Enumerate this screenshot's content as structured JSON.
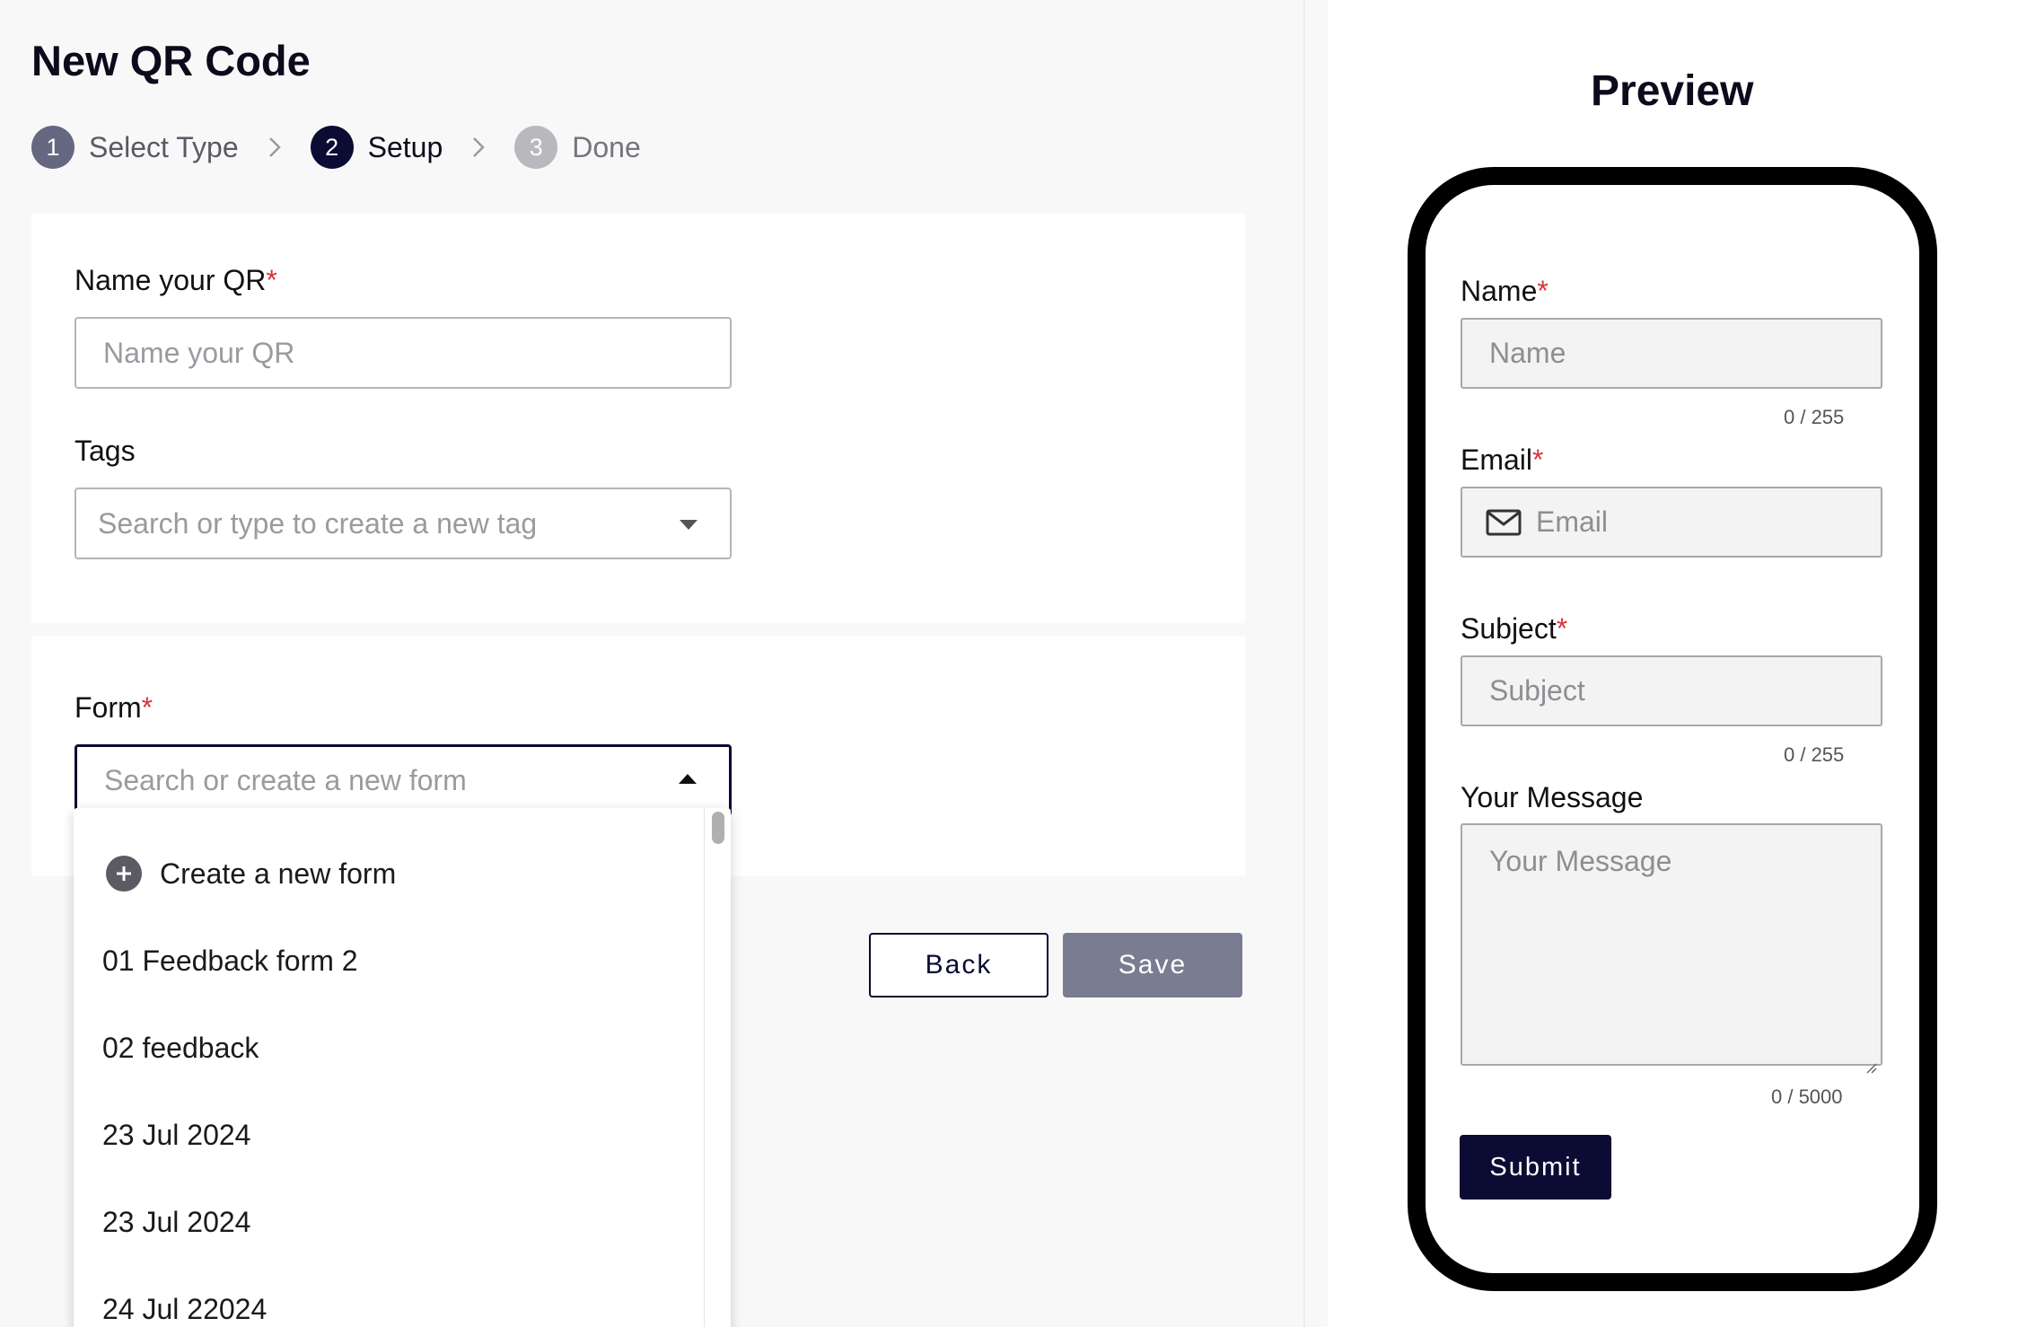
{
  "page": {
    "title": "New QR Code"
  },
  "stepper": {
    "steps": [
      {
        "number": "1",
        "label": "Select Type",
        "state": "completed"
      },
      {
        "number": "2",
        "label": "Setup",
        "state": "active"
      },
      {
        "number": "3",
        "label": "Done",
        "state": "upcoming"
      }
    ]
  },
  "setup_form": {
    "name_label": "Name your QR",
    "name_placeholder": "Name your QR",
    "tags_label": "Tags",
    "tags_placeholder": "Search or type to create a new tag",
    "form_label": "Form",
    "form_placeholder": "Search or create a new form",
    "required_marker": "*"
  },
  "form_dropdown": {
    "create_label": "Create a new form",
    "options": [
      "01 Feedback form 2",
      "02 feedback",
      "23 Jul 2024",
      "23 Jul 2024",
      "24 Jul 22024"
    ]
  },
  "actions": {
    "back_label": "Back",
    "save_label": "Save"
  },
  "preview": {
    "title": "Preview",
    "name_label": "Name",
    "name_placeholder": "Name",
    "name_count": "0 / 255",
    "email_label": "Email",
    "email_placeholder": "Email",
    "subject_label": "Subject",
    "subject_placeholder": "Subject",
    "subject_count": "0 / 255",
    "message_label": "Your Message",
    "message_placeholder": "Your Message",
    "message_count": "0 / 5000",
    "submit_label": "Submit",
    "required_marker": "*"
  },
  "colors": {
    "primary": "#0b0b33",
    "save_disabled": "#7a7c92",
    "required": "#d8343d"
  }
}
